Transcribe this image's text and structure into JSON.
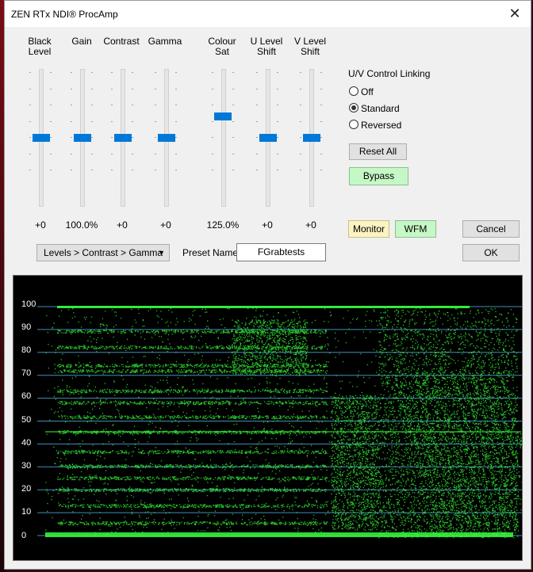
{
  "window": {
    "title": "ZEN RTx NDI® ProcAmp",
    "close_glyph": "✕"
  },
  "sliders": [
    {
      "label_l1": "Black",
      "label_l2": "Level",
      "value": "+0"
    },
    {
      "label_l1": "Gain",
      "label_l2": "",
      "value": "100.0%"
    },
    {
      "label_l1": "Contrast",
      "label_l2": "",
      "value": "+0"
    },
    {
      "label_l1": "Gamma",
      "label_l2": "",
      "value": "+0"
    },
    {
      "label_l1": "Colour",
      "label_l2": "Sat",
      "value": "125.0%"
    },
    {
      "label_l1": "U Level",
      "label_l2": "Shift",
      "value": "+0"
    },
    {
      "label_l1": "V Level",
      "label_l2": "Shift",
      "value": "+0"
    }
  ],
  "uv_linking": {
    "title": "U/V Control Linking",
    "options": [
      "Off",
      "Standard",
      "Reversed"
    ],
    "selected": "Standard"
  },
  "buttons": {
    "reset_all": "Reset All",
    "bypass": "Bypass",
    "monitor": "Monitor",
    "wfm": "WFM",
    "cancel": "Cancel",
    "ok": "OK"
  },
  "order_select": {
    "value": "Levels > Contrast > Gamma",
    "arrow": "▼"
  },
  "preset": {
    "label": "Preset Name",
    "value": "FGrabtests"
  },
  "waveform": {
    "scale": [
      "100",
      "90",
      "80",
      "70",
      "60",
      "50",
      "40",
      "30",
      "20",
      "10",
      "0"
    ],
    "trace_color": "#35ff3a",
    "grid_color": "#4ea7d8"
  }
}
